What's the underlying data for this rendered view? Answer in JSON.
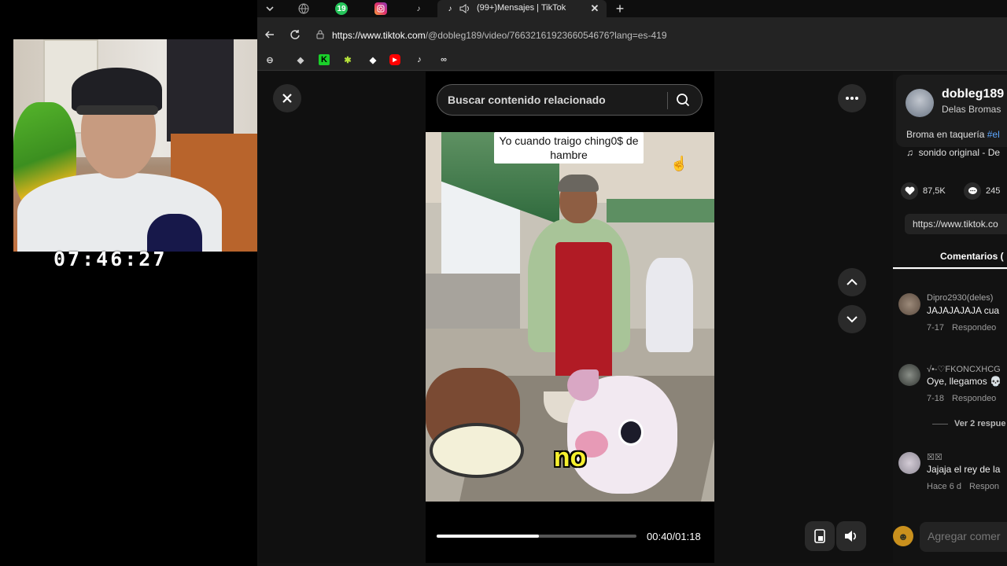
{
  "webcam": {
    "clock": "07:46:27"
  },
  "browser": {
    "tabs": [
      {
        "icon": "chevron-down-icon"
      },
      {
        "icon": "globe-icon"
      },
      {
        "icon": "badge-19-icon",
        "badge": "19"
      },
      {
        "icon": "instagram-icon"
      },
      {
        "icon": "tiktok-icon"
      }
    ],
    "active_tab": {
      "title": "(99+)Mensajes | TikTok"
    },
    "url": {
      "host": "https://www.tiktok.com",
      "path": "/@dobleg189/video/7663216192366054676?lang=es-419"
    }
  },
  "viewer": {
    "search_placeholder": "Buscar contenido relacionado",
    "caption_top": "Yo cuando traigo ching0$ de hambre",
    "caption_sub": "no",
    "progress": 0.51,
    "time": "00:40/01:18"
  },
  "side": {
    "author_name": "dobleg189",
    "author_sub": "Delas Bromas",
    "description": "Broma en taquería ",
    "description_tag": "#el",
    "sound": "sonido original - De",
    "likes": "87,5K",
    "comments_count": "245",
    "link": "https://www.tiktok.co",
    "comments_tab": "Comentarios (",
    "comments": [
      {
        "user": "Dipro2930(deles)",
        "text": "JAJAJAJAJA cua",
        "date": "7-17",
        "reply": "Respondeo"
      },
      {
        "user": "√•-♡FKONCXHCG",
        "text": "Oye, llegamos 💀",
        "date": "7-18",
        "reply": "Respondeo"
      },
      {
        "user": "☒☒",
        "text": "Jajaja el rey de la",
        "date": "Hace 6 d",
        "reply": "Respon"
      }
    ],
    "view_replies": "Ver 2 respue",
    "add_comment": "Agregar comer"
  }
}
